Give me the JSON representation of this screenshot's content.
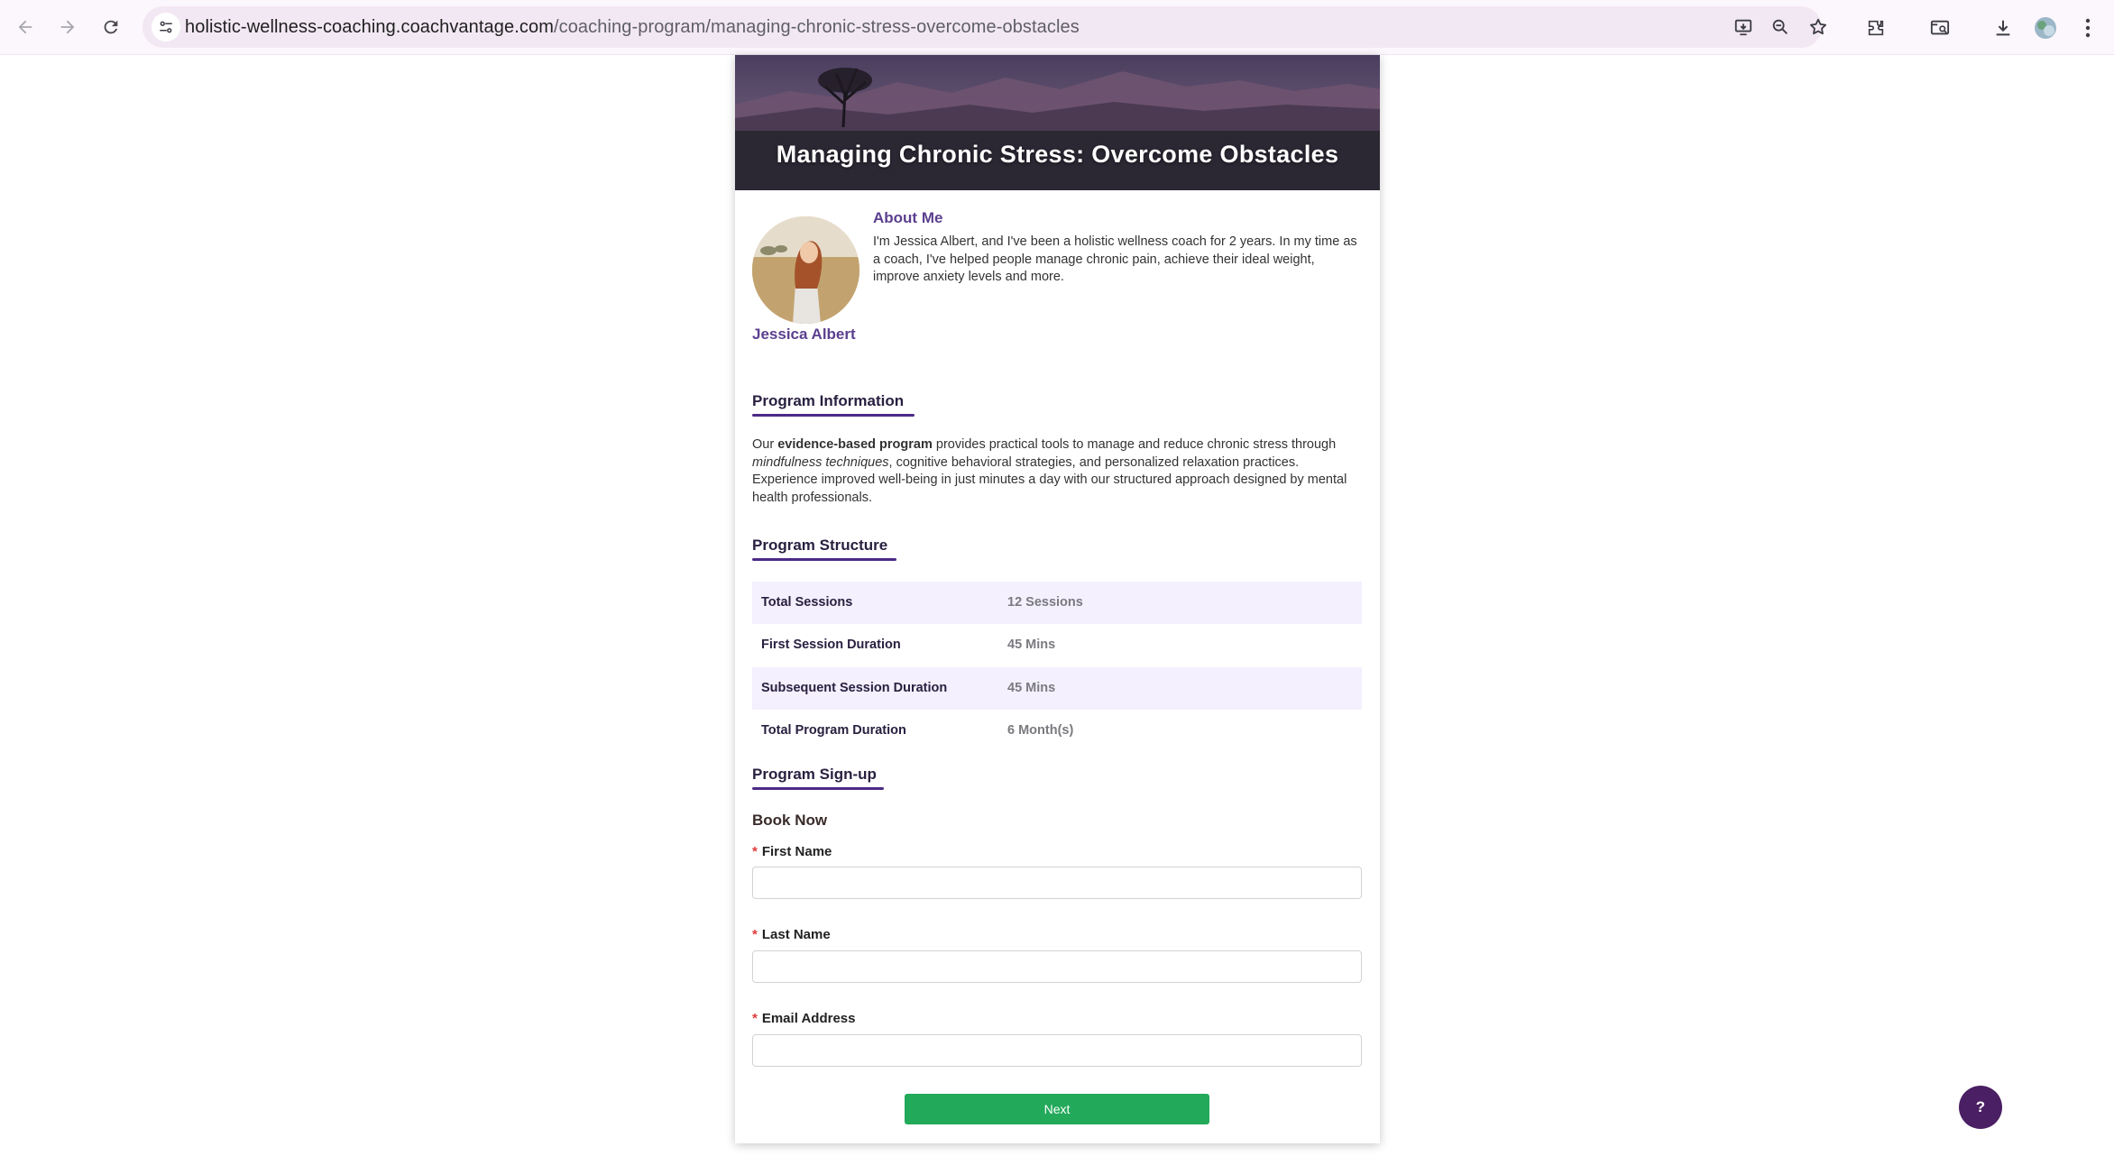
{
  "browser": {
    "url_domain": "holistic-wellness-coaching.coachvantage.com",
    "url_path": "/coaching-program/managing-chronic-stress-overcome-obstacles",
    "icons": [
      "back-icon",
      "forward-icon",
      "reload-icon",
      "site-settings-icon",
      "install-app-icon",
      "zoom-icon",
      "bookmark-star-icon",
      "extensions-icon",
      "tab-search-icon",
      "downloads-icon",
      "profile-avatar",
      "menu-icon"
    ]
  },
  "hero": {
    "title": "Managing Chronic Stress: Overcome Obstacles"
  },
  "about": {
    "heading": "About Me",
    "text": "I'm Jessica Albert, and I've been a holistic wellness coach for 2 years. In my time as a coach, I've helped people manage chronic pain, achieve their ideal weight, improve anxiety levels and more.",
    "coach_name": "Jessica Albert"
  },
  "program_info": {
    "title": "Program Information",
    "text_before": "Our ",
    "text_bold": "evidence-based program",
    "text_middle": " provides practical tools to manage and reduce chronic stress through ",
    "text_italic": "mindfulness techniques",
    "text_after": ", cognitive behavioral strategies, and personalized relaxation practices. Experience improved well-being in just minutes a day with our structured approach designed by mental health professionals."
  },
  "program_structure": {
    "title": "Program Structure",
    "rows": [
      {
        "label": "Total Sessions",
        "value": "12 Sessions"
      },
      {
        "label": "First Session Duration",
        "value": "45 Mins"
      },
      {
        "label": "Subsequent Session Duration",
        "value": "45 Mins"
      },
      {
        "label": "Total Program Duration",
        "value": "6 Month(s)"
      }
    ]
  },
  "signup": {
    "title": "Program Sign-up",
    "book_now": "Book Now",
    "required_mark": "*",
    "fields": [
      {
        "label": "First Name",
        "value": ""
      },
      {
        "label": "Last Name",
        "value": ""
      },
      {
        "label": "Email Address",
        "value": ""
      }
    ],
    "next_label": "Next"
  },
  "help": {
    "label": "?"
  },
  "colors": {
    "accent": "#4b2a86",
    "heading": "#5b3f8f",
    "button": "#22a95a",
    "help": "#4a1f63",
    "row_alt": "#f4f0fe"
  }
}
